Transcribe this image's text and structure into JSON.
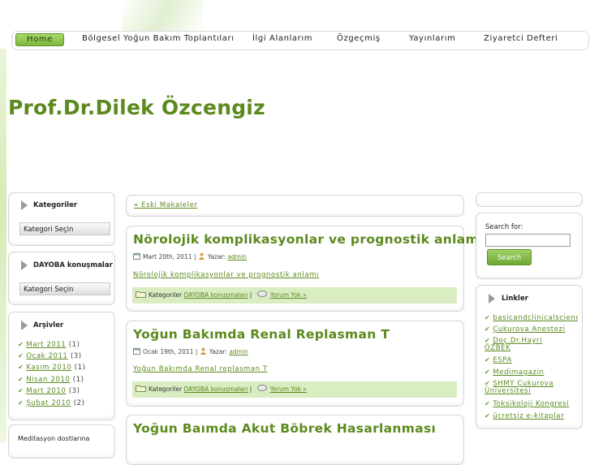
{
  "nav": {
    "items": [
      "Home",
      "Bölgesel Yoğun Bakım Toplantıları",
      "İlgi Alanlarım",
      "Özgeçmiş",
      "Yayınlarım",
      "Ziyaretci Defteri"
    ]
  },
  "site_title": "Prof.Dr.Dilek Özcengiz",
  "sidebar_left": {
    "kategoriler": {
      "title": "Kategoriler",
      "select": "Kategori Seçin"
    },
    "dayoba": {
      "title": "DAYOBA konuşmalar",
      "select": "Kategori Seçin"
    },
    "arsivler": {
      "title": "Arşivler",
      "items": [
        {
          "label": "Mart 2011",
          "count": "(1)"
        },
        {
          "label": "Ocak 2011",
          "count": "(3)"
        },
        {
          "label": "Kasım 2010",
          "count": "(1)"
        },
        {
          "label": "Nisan 2010",
          "count": "(1)"
        },
        {
          "label": "Mart 2010",
          "count": "(3)"
        },
        {
          "label": "Şubat 2010",
          "count": "(2)"
        }
      ]
    },
    "meditasyon": {
      "text": "Meditasyon dostlarına"
    }
  },
  "main": {
    "older_link": "« Eski Makaleler",
    "posts": [
      {
        "title": "Nörolojik komplikasyonlar ve prognostik anlamı",
        "date": "Mart 20th, 2011",
        "sep": "|",
        "author_label": "Yazar:",
        "author": "admin",
        "excerpt": "Nörolojik komplikasyonlar ve prognostik anlamı",
        "cat_label": "Kategoriler",
        "category": "DAYOBA konuşmaları",
        "comments": "Yorum Yok »"
      },
      {
        "title": "Yoğun Bakımda Renal Replasman T",
        "date": "Ocak 19th, 2011",
        "sep": "|",
        "author_label": "Yazar:",
        "author": "admin",
        "excerpt": "Yoğun Bakımda Renal replasman T",
        "cat_label": "Kategoriler",
        "category": "DAYOBA konuşmaları",
        "comments": "Yorum Yok »"
      },
      {
        "title": "Yoğun Baımda Akut Böbrek Hasarlanması"
      }
    ]
  },
  "sidebar_right": {
    "search_label": "Search for:",
    "search_value": "",
    "search_button": "Search",
    "links_title": "Linkler",
    "links": [
      "basicandclinicalscienc",
      "Çukurova Anestezi",
      "Doç.Dr.Hayri ÖZBEK",
      "ESPA",
      "Medimagazin",
      "SHMY Çukurova Üniversitesi",
      "Toksikoloji Kongresi",
      "ücretsiz e-kitaplar"
    ]
  }
}
